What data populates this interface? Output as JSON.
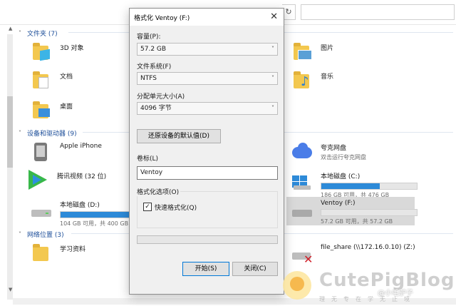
{
  "sections": {
    "folders": "文件夹 (7)",
    "devices": "设备和驱动器 (9)",
    "network": "网络位置 (3)"
  },
  "folders": {
    "objects3d": "3D 对象",
    "pictures": "图片",
    "documents": "文档",
    "music": "音乐",
    "desktop": "桌面"
  },
  "devices": {
    "iphone": "Apple iPhone",
    "quark_name": "夸克网盘",
    "quark_sub": "双击运行夸克网盘",
    "tencent": "腾讯视频 (32 位)",
    "disk_c_name": "本地磁盘 (C:)",
    "disk_c_info": "186 GB 可用，共 476 GB",
    "disk_c_used": 0.61,
    "disk_d_name": "本地磁盘 (D:)",
    "disk_d_info": "104 GB 可用，共 400 GB",
    "disk_d_used": 0.74,
    "ventoy_name": "Ventoy (F:)",
    "ventoy_info": "57.2 GB 可用，共 57.2 GB",
    "ventoy_used": 0.0
  },
  "network": {
    "study": "学习资料",
    "share": "file_share (\\\\172.16.0.10) (Z:)"
  },
  "dialog": {
    "title": "格式化 Ventoy (F:)",
    "capacity_label": "容量(P):",
    "capacity_value": "57.2 GB",
    "fs_label": "文件系统(F)",
    "fs_value": "NTFS",
    "alloc_label": "分配单元大小(A)",
    "alloc_value": "4096 字节",
    "restore_button": "还原设备的默认值(D)",
    "volume_label": "卷标(L)",
    "volume_value": "Ventoy",
    "options_label": "格式化选项(O)",
    "quick_format": "快速格式化(Q)",
    "start_button": "开始(S)",
    "close_button": "关闭(C)"
  },
  "watermark": {
    "title": "CutePigBlog",
    "subtitle": "理无专在学无止境",
    "handle": "@小毛驴子"
  },
  "colors": {
    "accent": "#2d8ad8",
    "section_text": "#1e4f9a",
    "folder": "#f3c84f"
  }
}
